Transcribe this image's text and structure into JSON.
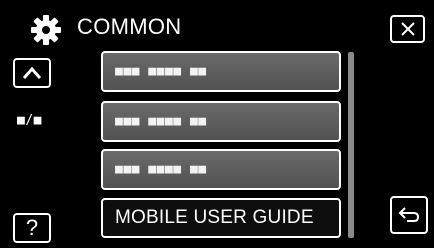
{
  "header": {
    "title": "COMMON",
    "icon": "gear-icon"
  },
  "controls": {
    "close_icon": "close-icon",
    "up_icon": "up-arrow-icon",
    "help_label": "?",
    "back_icon": "return-icon"
  },
  "page_indicator": "■/■",
  "menu": {
    "items": [
      {
        "label": "■■■ ■■■■ ■■"
      },
      {
        "label": "■■■ ■■■■ ■■"
      },
      {
        "label": "■■■ ■■■■ ■■"
      },
      {
        "label": "MOBILE USER GUIDE"
      }
    ],
    "selected_index": 3
  },
  "colors": {
    "background": "#000000",
    "item_fill": "#606060",
    "item_border": "#ffffff",
    "scrollbar": "#8a8a8a"
  }
}
